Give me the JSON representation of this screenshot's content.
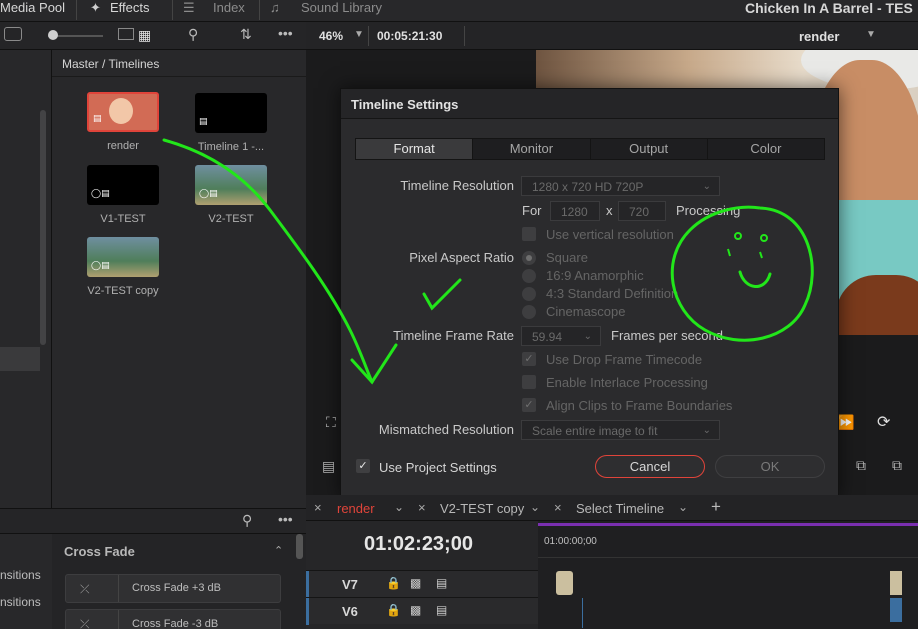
{
  "topbar": {
    "media_pool": "Media Pool",
    "effects": "Effects",
    "index": "Index",
    "sound_library": "Sound Library",
    "project_title": "Chicken In A Barrel - TES"
  },
  "pool": {
    "breadcrumb": "Master / Timelines",
    "clips": [
      {
        "label": "render"
      },
      {
        "label": "Timeline 1 -..."
      },
      {
        "label": "V1-TEST"
      },
      {
        "label": "V2-TEST"
      },
      {
        "label": "V2-TEST copy"
      }
    ]
  },
  "viewer": {
    "zoom": "46%",
    "timecode": "00:05:21:30",
    "timeline_name": "render"
  },
  "dialog": {
    "title": "Timeline Settings",
    "tabs": [
      "Format",
      "Monitor",
      "Output",
      "Color"
    ],
    "resolution_label": "Timeline Resolution",
    "resolution_value": "1280 x 720 HD 720P",
    "for_label": "For",
    "width": "1280",
    "x_label": "x",
    "height": "720",
    "processing_label": "Processing",
    "vertical_label": "Use vertical resolution",
    "par_label": "Pixel Aspect Ratio",
    "par_options": [
      "Square",
      "16:9 Anamorphic",
      "4:3 Standard Definition",
      "Cinemascope"
    ],
    "frame_rate_label": "Timeline Frame Rate",
    "frame_rate_value": "59.94",
    "fps_label": "Frames per second",
    "drop_frame_label": "Use Drop Frame Timecode",
    "interlace_label": "Enable Interlace Processing",
    "align_label": "Align Clips to Frame Boundaries",
    "mismatched_label": "Mismatched Resolution",
    "mismatched_value": "Scale entire image to fit",
    "use_project_label": "Use Project Settings",
    "cancel": "Cancel",
    "ok": "OK"
  },
  "effects": {
    "section": "Cross Fade",
    "side_labels": [
      "nsitions",
      "nsitions"
    ],
    "items": [
      "Cross Fade +3 dB",
      "Cross Fade -3 dB"
    ]
  },
  "timeline": {
    "tabs": [
      "render",
      "V2-TEST copy",
      "Select Timeline"
    ],
    "timecode": "01:02:23;00",
    "ruler_start": "01:00:00;00",
    "tracks": [
      "V7",
      "V6"
    ]
  },
  "colors": {
    "accent_red": "#e0443a",
    "annotation_green": "#22e61a"
  }
}
